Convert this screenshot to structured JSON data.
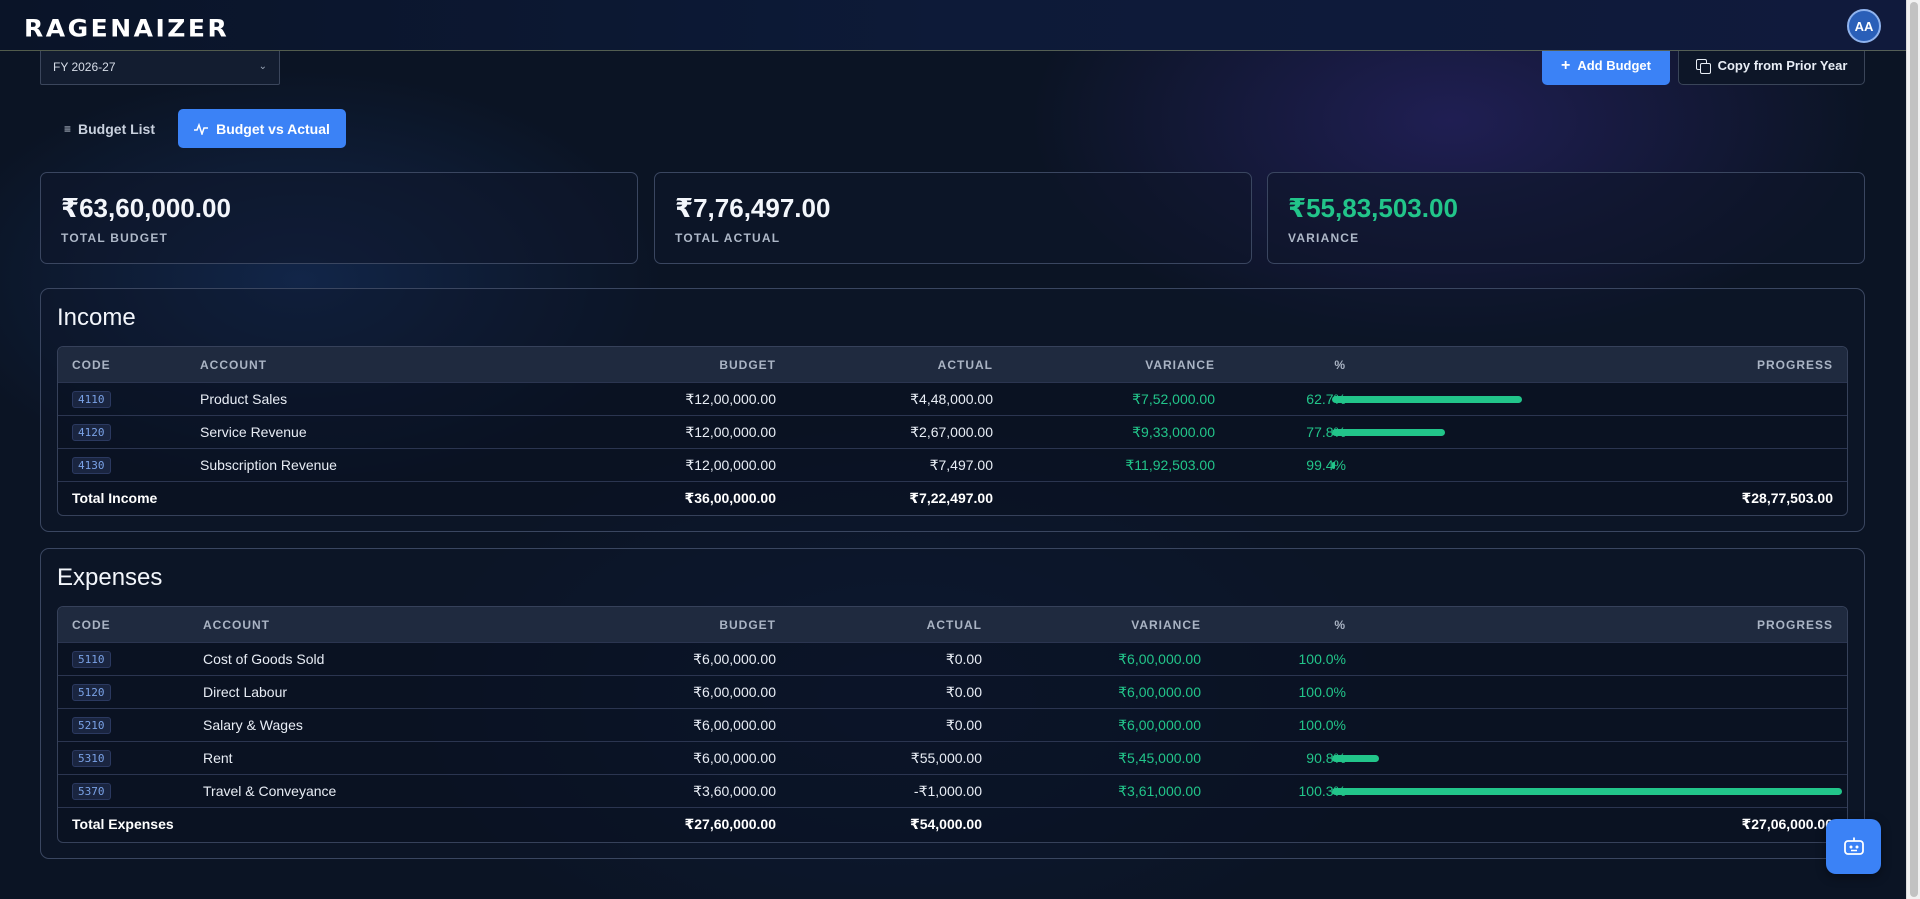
{
  "app": {
    "logo": "RAGENAIZER",
    "avatar_initials": "AA"
  },
  "toolbar": {
    "fiscal_year": "FY 2026-27",
    "add_budget_label": "Add Budget",
    "copy_prior_label": "Copy from Prior Year"
  },
  "tabs": [
    {
      "label": "Budget List",
      "active": false
    },
    {
      "label": "Budget vs Actual",
      "active": true
    }
  ],
  "summary": {
    "total_budget": {
      "value": "₹63,60,000.00",
      "label": "TOTAL BUDGET"
    },
    "total_actual": {
      "value": "₹7,76,497.00",
      "label": "TOTAL ACTUAL"
    },
    "variance": {
      "value": "₹55,83,503.00",
      "label": "VARIANCE"
    }
  },
  "income": {
    "title": "Income",
    "columns": [
      "CODE",
      "ACCOUNT",
      "BUDGET",
      "ACTUAL",
      "VARIANCE",
      "%",
      "PROGRESS"
    ],
    "rows": [
      {
        "code": "4110",
        "account": "Product Sales",
        "budget": "₹12,00,000.00",
        "actual": "₹4,48,000.00",
        "variance": "₹7,52,000.00",
        "pct": "62.7%",
        "progress": 0.373
      },
      {
        "code": "4120",
        "account": "Service Revenue",
        "budget": "₹12,00,000.00",
        "actual": "₹2,67,000.00",
        "variance": "₹9,33,000.00",
        "pct": "77.8%",
        "progress": 0.222
      },
      {
        "code": "4130",
        "account": "Subscription Revenue",
        "budget": "₹12,00,000.00",
        "actual": "₹7,497.00",
        "variance": "₹11,92,503.00",
        "pct": "99.4%",
        "progress": 0.006
      }
    ],
    "total": {
      "label": "Total Income",
      "budget": "₹36,00,000.00",
      "actual": "₹7,22,497.00",
      "variance": "₹28,77,503.00"
    }
  },
  "expenses": {
    "title": "Expenses",
    "columns": [
      "CODE",
      "ACCOUNT",
      "BUDGET",
      "ACTUAL",
      "VARIANCE",
      "%",
      "PROGRESS"
    ],
    "rows": [
      {
        "code": "5110",
        "account": "Cost of Goods Sold",
        "budget": "₹6,00,000.00",
        "actual": "₹0.00",
        "variance": "₹6,00,000.00",
        "pct": "100.0%",
        "progress": 0
      },
      {
        "code": "5120",
        "account": "Direct Labour",
        "budget": "₹6,00,000.00",
        "actual": "₹0.00",
        "variance": "₹6,00,000.00",
        "pct": "100.0%",
        "progress": 0
      },
      {
        "code": "5210",
        "account": "Salary & Wages",
        "budget": "₹6,00,000.00",
        "actual": "₹0.00",
        "variance": "₹6,00,000.00",
        "pct": "100.0%",
        "progress": 0
      },
      {
        "code": "5310",
        "account": "Rent",
        "budget": "₹6,00,000.00",
        "actual": "₹55,000.00",
        "variance": "₹5,45,000.00",
        "pct": "90.8%",
        "progress": 0.092
      },
      {
        "code": "5370",
        "account": "Travel & Conveyance",
        "budget": "₹3,60,000.00",
        "actual": "-₹1,000.00",
        "variance": "₹3,61,000.00",
        "pct": "100.3%",
        "progress": 1.0
      }
    ],
    "total": {
      "label": "Total Expenses",
      "budget": "₹27,60,000.00",
      "actual": "₹54,000.00",
      "variance": "₹27,06,000.00"
    }
  },
  "colors": {
    "accent": "#3b82f6",
    "positive": "#22c58a",
    "background": "#0b1424"
  }
}
